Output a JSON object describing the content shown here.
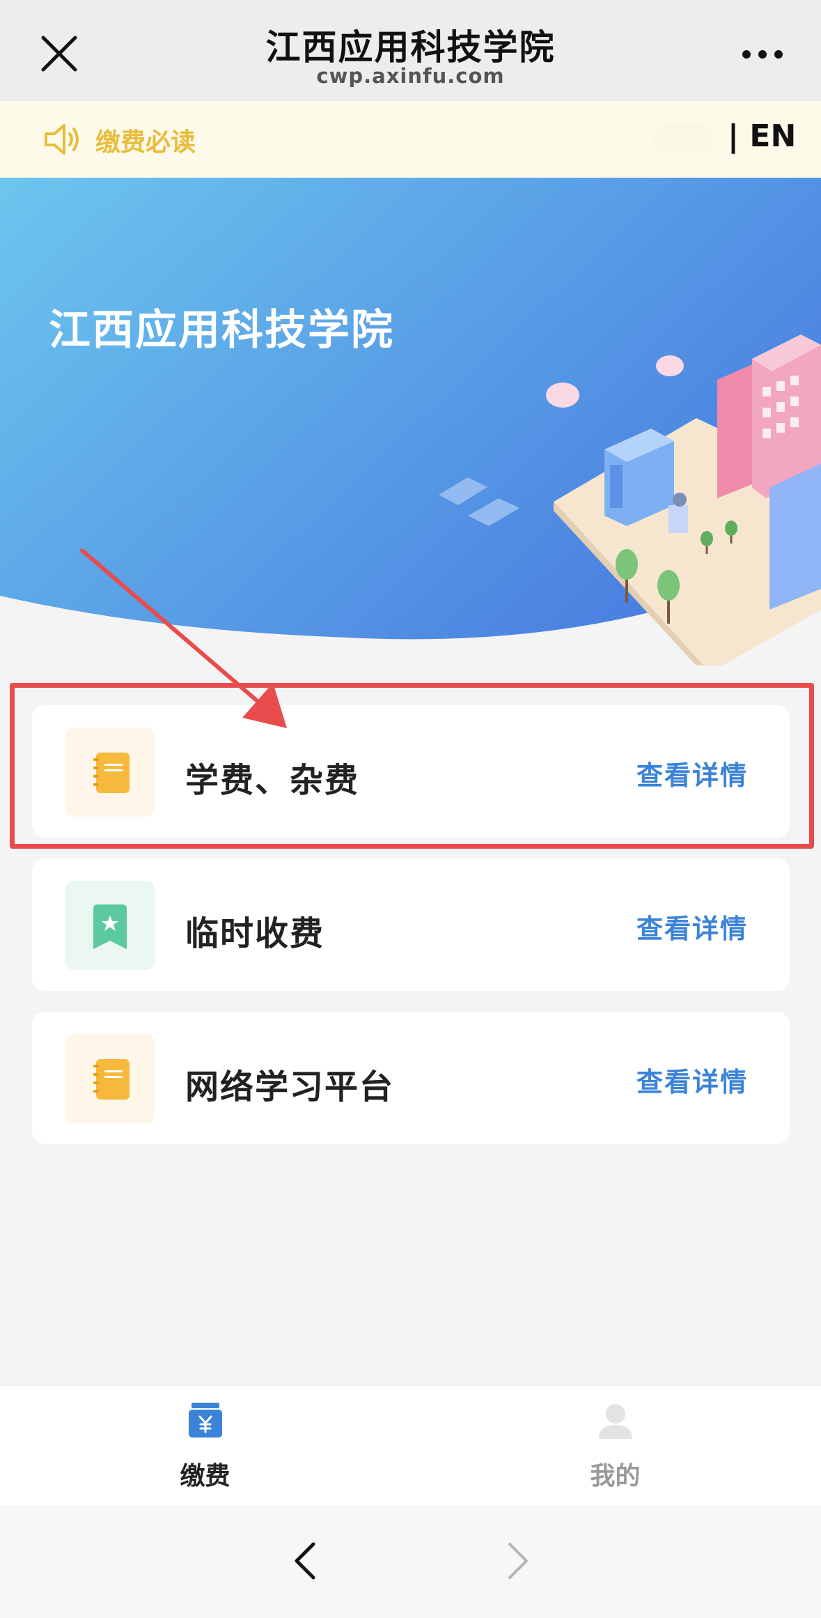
{
  "header": {
    "title": "江西应用科技学院",
    "url": "cwp.axinfu.com",
    "close_icon": "close-icon",
    "more_icon": "more-icon"
  },
  "notice": {
    "icon": "speaker-icon",
    "text": "缴费必读",
    "lang_label": "| EN"
  },
  "hero": {
    "title": "江西应用科技学院"
  },
  "items": [
    {
      "label": "学费、杂费",
      "link": "查看详情",
      "icon": "notebook-icon",
      "icon_color": "#f6b93b"
    },
    {
      "label": "临时收费",
      "link": "查看详情",
      "icon": "bookmark-star-icon",
      "icon_color": "#5ccaa0"
    },
    {
      "label": "网络学习平台",
      "link": "查看详情",
      "icon": "notebook-icon",
      "icon_color": "#f6b93b"
    }
  ],
  "tabbar": {
    "tabs": [
      {
        "label": "缴费",
        "icon": "yen-wallet-icon",
        "active": true
      },
      {
        "label": "我的",
        "icon": "user-icon",
        "active": false
      }
    ]
  },
  "colors": {
    "accent_blue": "#3b83d8",
    "notice_yellow": "#e8bc3c",
    "highlight_red": "#e84c4c"
  }
}
